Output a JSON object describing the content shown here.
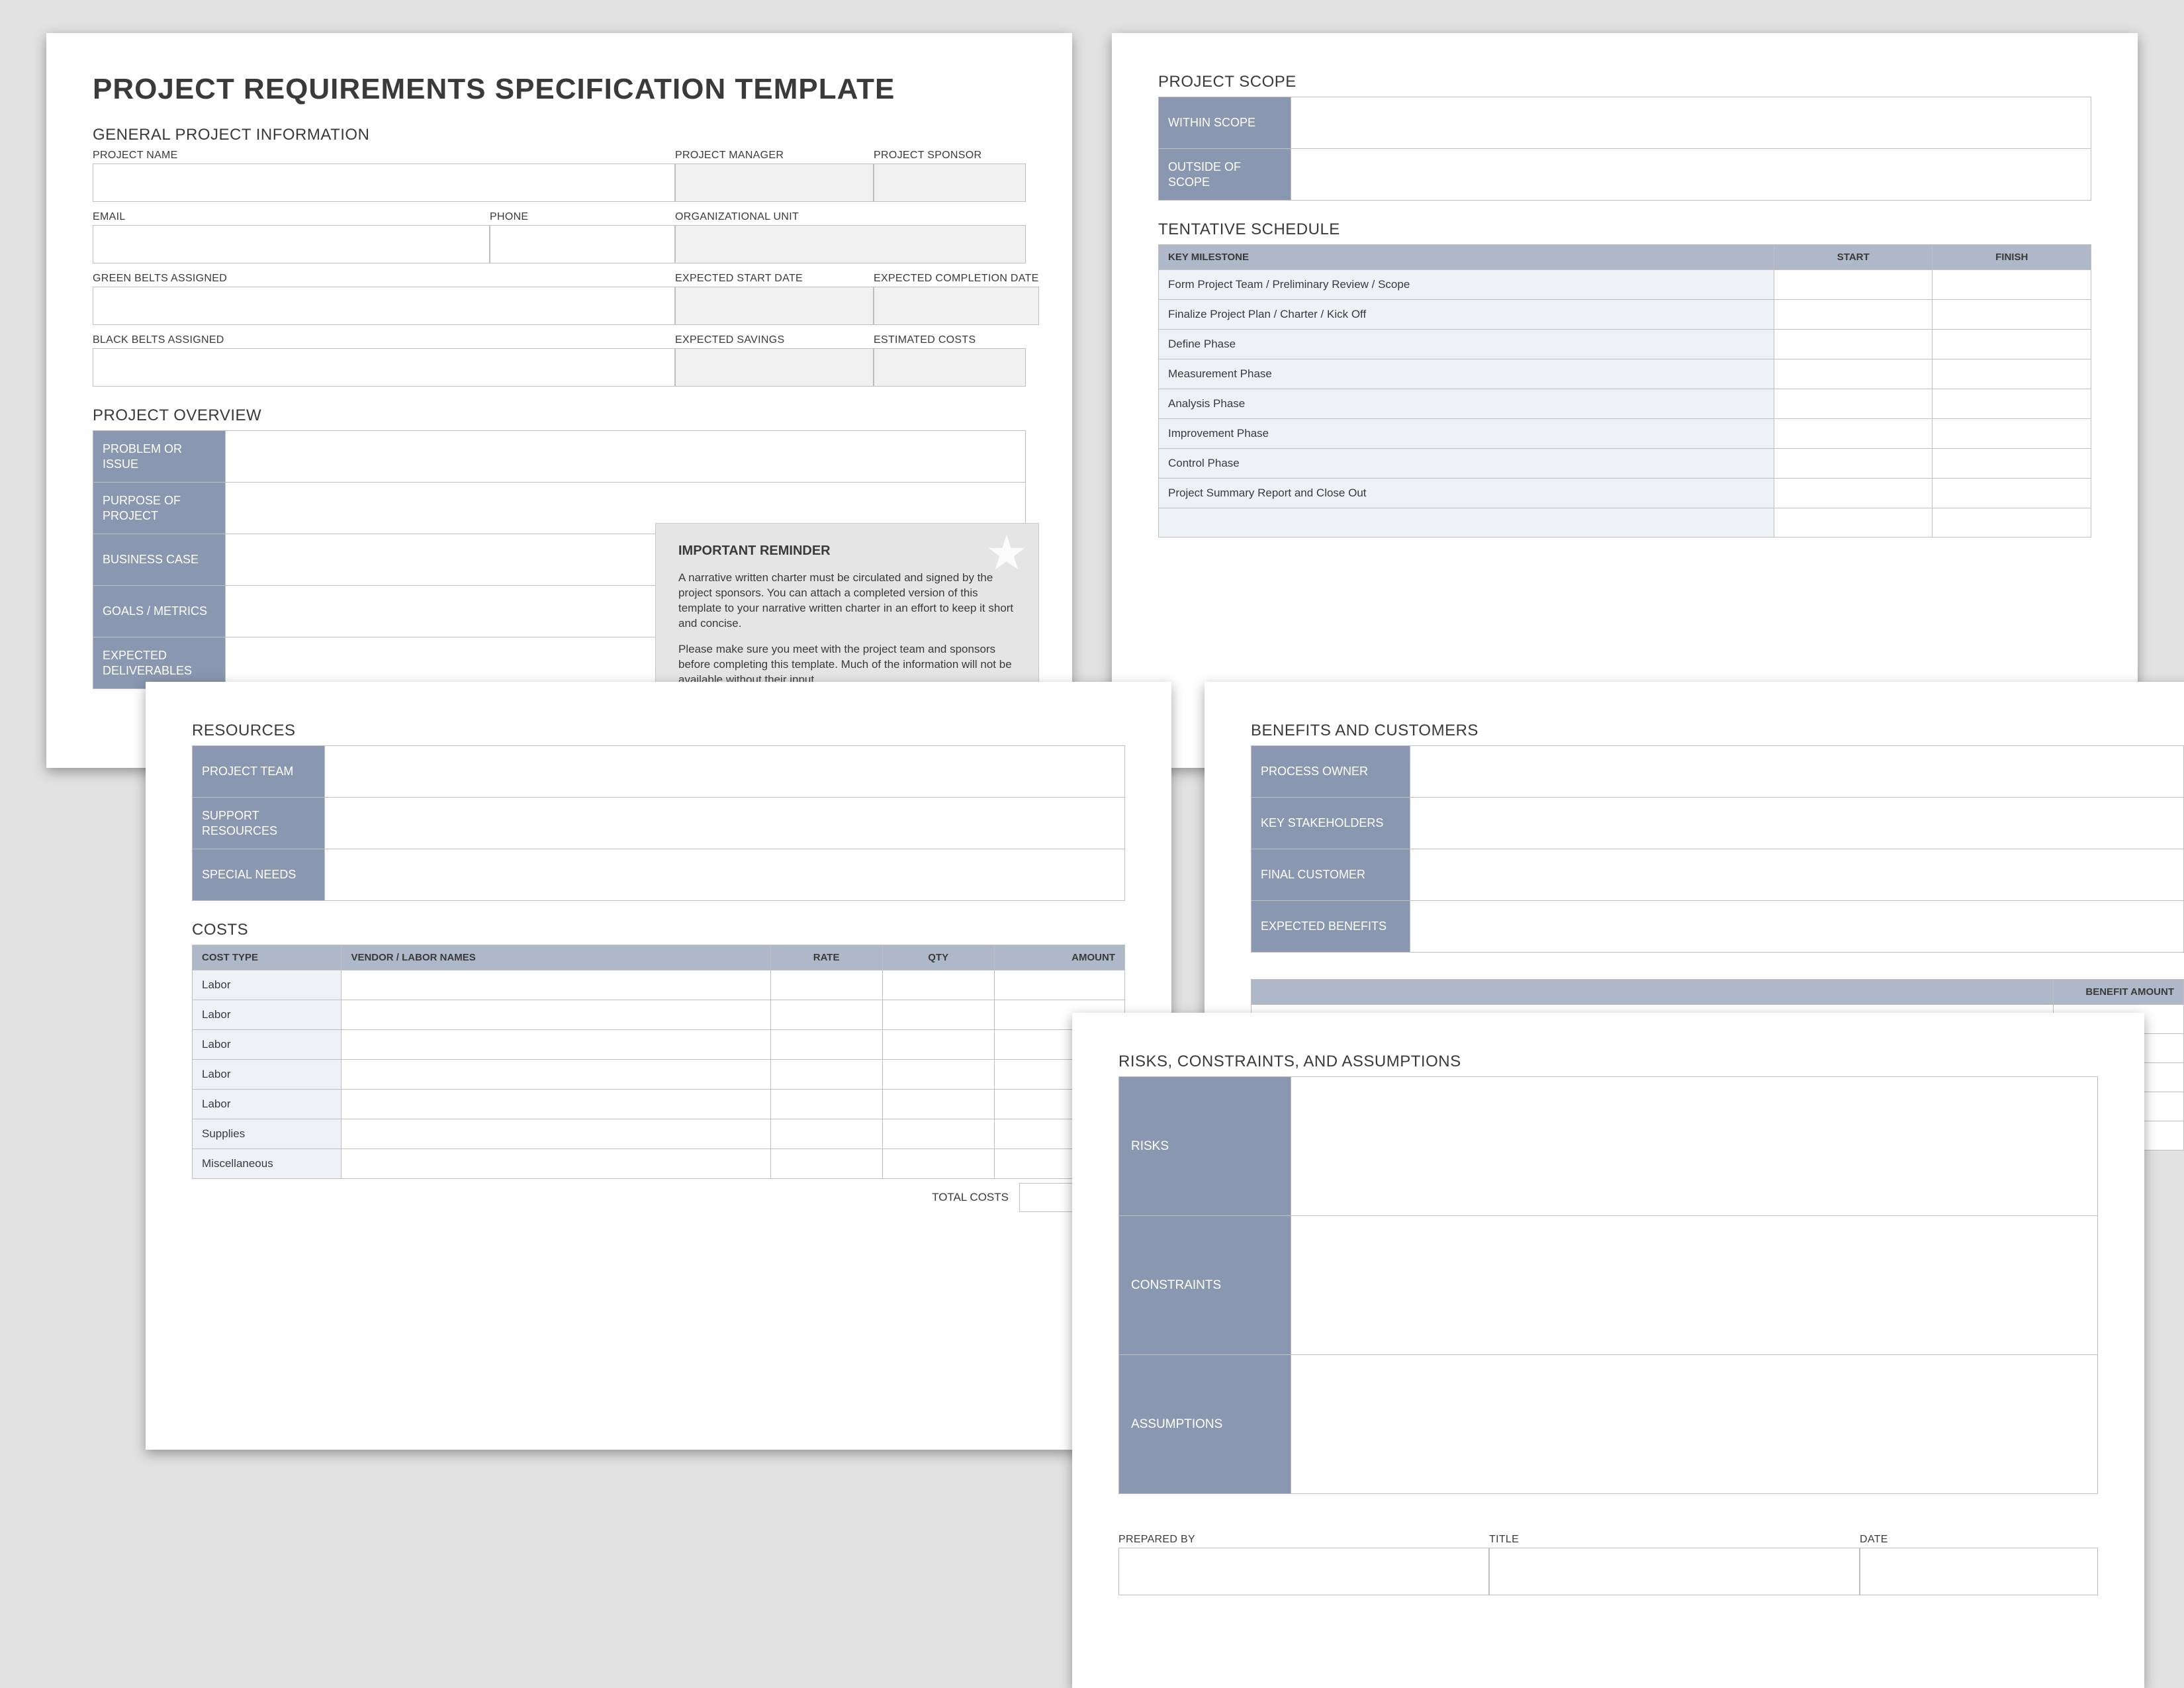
{
  "doc": {
    "title": "PROJECT REQUIREMENTS SPECIFICATION TEMPLATE"
  },
  "general": {
    "heading": "GENERAL PROJECT INFORMATION",
    "project_name": "PROJECT NAME",
    "project_manager": "PROJECT MANAGER",
    "project_sponsor": "PROJECT SPONSOR",
    "email": "EMAIL",
    "phone": "PHONE",
    "org_unit": "ORGANIZATIONAL UNIT",
    "green_belts": "GREEN BELTS ASSIGNED",
    "exp_start": "EXPECTED START DATE",
    "exp_completion": "EXPECTED COMPLETION DATE",
    "black_belts": "BLACK BELTS ASSIGNED",
    "exp_savings": "EXPECTED SAVINGS",
    "est_costs": "ESTIMATED COSTS"
  },
  "overview": {
    "heading": "PROJECT OVERVIEW",
    "rows": [
      "PROBLEM OR ISSUE",
      "PURPOSE OF PROJECT",
      "BUSINESS CASE",
      "GOALS / METRICS",
      "EXPECTED DELIVERABLES"
    ]
  },
  "callout": {
    "title": "IMPORTANT REMINDER",
    "p1": "A narrative written charter must be circulated and signed by the project sponsors. You can attach a completed version of this template to your narrative written charter in an effort to keep it short and concise.",
    "p2": "Please make sure you meet with the project team and sponsors before completing this template. Much of the information will not be available without their input."
  },
  "scope": {
    "heading": "PROJECT SCOPE",
    "rows": [
      "WITHIN SCOPE",
      "OUTSIDE OF SCOPE"
    ]
  },
  "schedule": {
    "heading": "TENTATIVE SCHEDULE",
    "cols": [
      "KEY MILESTONE",
      "START",
      "FINISH"
    ],
    "rows": [
      "Form Project Team / Preliminary Review / Scope",
      "Finalize Project Plan / Charter / Kick Off",
      "Define Phase",
      "Measurement Phase",
      "Analysis Phase",
      "Improvement Phase",
      "Control Phase",
      "Project Summary Report and Close Out"
    ]
  },
  "resources": {
    "heading": "RESOURCES",
    "rows": [
      "PROJECT TEAM",
      "SUPPORT RESOURCES",
      "SPECIAL NEEDS"
    ]
  },
  "costs": {
    "heading": "COSTS",
    "cols": [
      "COST TYPE",
      "VENDOR / LABOR NAMES",
      "RATE",
      "QTY",
      "AMOUNT"
    ],
    "rows": [
      "Labor",
      "Labor",
      "Labor",
      "Labor",
      "Labor",
      "Supplies",
      "Miscellaneous"
    ],
    "total_label": "TOTAL COSTS"
  },
  "benefits": {
    "heading": "BENEFITS AND CUSTOMERS",
    "rows": [
      "PROCESS OWNER",
      "KEY STAKEHOLDERS",
      "FINAL CUSTOMER",
      "EXPECTED BENEFITS"
    ],
    "amount_col": "BENEFIT AMOUNT"
  },
  "risks": {
    "heading": "RISKS, CONSTRAINTS, AND ASSUMPTIONS",
    "rows": [
      "RISKS",
      "CONSTRAINTS",
      "ASSUMPTIONS"
    ]
  },
  "signoff": {
    "prepared_by": "PREPARED BY",
    "title": "TITLE",
    "date": "DATE"
  }
}
